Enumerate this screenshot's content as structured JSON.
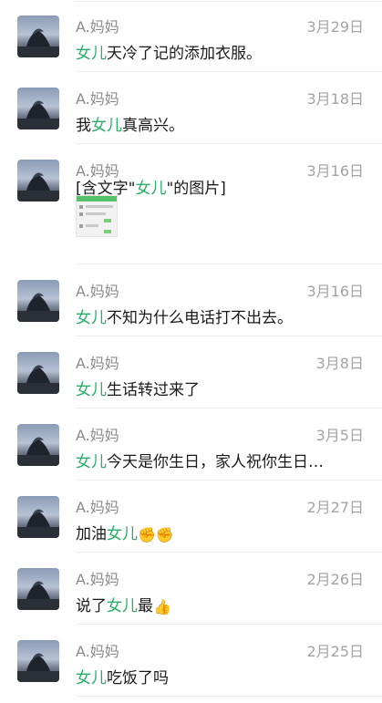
{
  "rows": [
    {
      "name": "A.妈妈",
      "date": "3月29日",
      "pre": "",
      "hl": "女儿",
      "post": "天冷了记的添加衣服。"
    },
    {
      "name": "A.妈妈",
      "date": "3月18日",
      "pre": "我",
      "hl": "女儿",
      "post": "真高兴。"
    },
    {
      "name": "A.妈妈",
      "date": "3月16日",
      "pre": "[含文字\"",
      "hl": "女儿",
      "post": "\"的图片]"
    },
    {
      "name": "A.妈妈",
      "date": "3月16日",
      "pre": "",
      "hl": "女儿",
      "post": "不知为什么电话打不出去。"
    },
    {
      "name": "A.妈妈",
      "date": "3月8日",
      "pre": "",
      "hl": "女儿",
      "post": "生话转过来了"
    },
    {
      "name": "A.妈妈",
      "date": "3月5日",
      "pre": "",
      "hl": "女儿",
      "post": "今天是你生日，家人祝你生日…"
    },
    {
      "name": "A.妈妈",
      "date": "2月27日",
      "pre": "加油",
      "hl": "女儿",
      "post": "",
      "emoji1": "✊",
      "emoji2": "✊"
    },
    {
      "name": "A.妈妈",
      "date": "2月26日",
      "pre": "说了",
      "hl": "女儿",
      "post": "最",
      "emoji1": "👍"
    },
    {
      "name": "A.妈妈",
      "date": "2月25日",
      "pre": "",
      "hl": "女儿",
      "post": "吃饭了吗"
    }
  ],
  "colors": {
    "highlight": "#2aae67",
    "name": "#8a8a8a",
    "date": "#a3a3a3"
  }
}
